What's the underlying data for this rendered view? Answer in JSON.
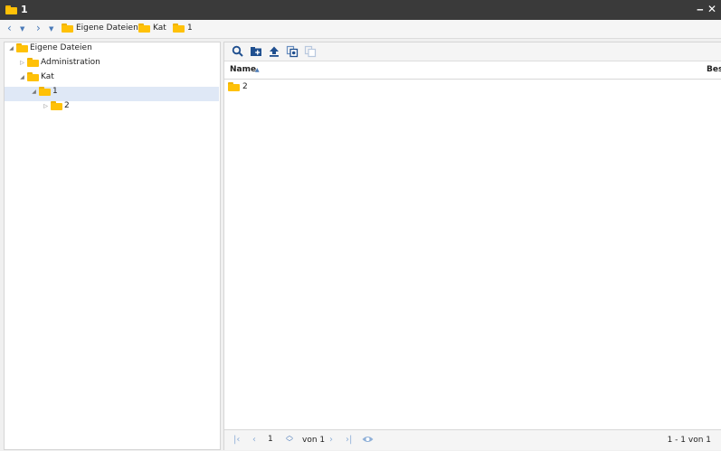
{
  "window": {
    "title": "1"
  },
  "breadcrumb": [
    "Eigene Dateien",
    "Kat",
    "1"
  ],
  "tree": {
    "nodes": [
      {
        "label": "Eigene Dateien",
        "level": 0,
        "expanded": true
      },
      {
        "label": "Administration",
        "level": 1,
        "expanded": false
      },
      {
        "label": "Kat",
        "level": 1,
        "expanded": true
      },
      {
        "label": "1",
        "level": 2,
        "expanded": true,
        "selected": true
      },
      {
        "label": "2",
        "level": 3,
        "expanded": false
      }
    ]
  },
  "grid": {
    "columns": {
      "name": "Name",
      "description": "Bes"
    },
    "sort": "ascending",
    "rows": [
      {
        "name": "2",
        "type": "folder"
      }
    ]
  },
  "pager": {
    "current_page": "1",
    "of_text": "von 1",
    "summary": "1 - 1 von 1"
  },
  "icons": {
    "toolbar": [
      "search-icon",
      "new-folder-icon",
      "upload-icon",
      "copy-icon",
      "paste-icon"
    ],
    "folder_color": "#ffc107",
    "accent": "#4a7ab8"
  }
}
